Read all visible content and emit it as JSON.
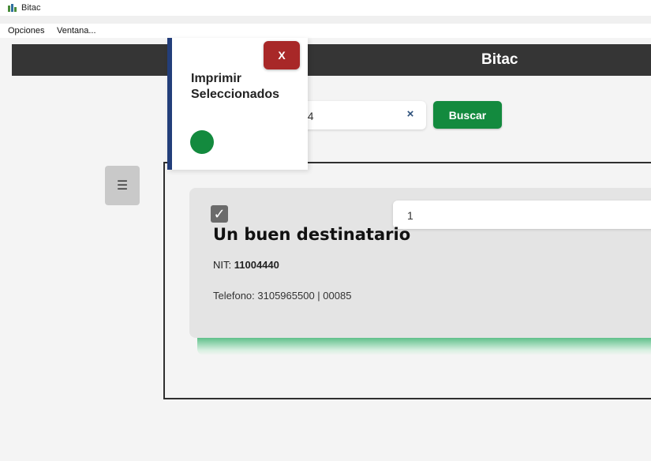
{
  "window": {
    "title": "Bitac"
  },
  "menubar": {
    "items": [
      "Opciones",
      "Ventana..."
    ]
  },
  "header": {
    "brand": "Bitac"
  },
  "search": {
    "value": "44",
    "clear_symbol": "×",
    "button_label": "Buscar"
  },
  "popup": {
    "title": "Imprimir Seleccionados",
    "close_label": "X"
  },
  "menu_toggle": {
    "symbol": "☰"
  },
  "card": {
    "checked_symbol": "✓",
    "quantity": "1",
    "title": "Un buen destinatario",
    "nit_label": "NIT:",
    "nit_value": "11004440",
    "phone_text": "Telefono: 3105965500 | 00085"
  },
  "colors": {
    "header": "#353535",
    "primary_green": "#138a3e",
    "close_red": "#a82828",
    "popup_accent": "#233e7a"
  }
}
